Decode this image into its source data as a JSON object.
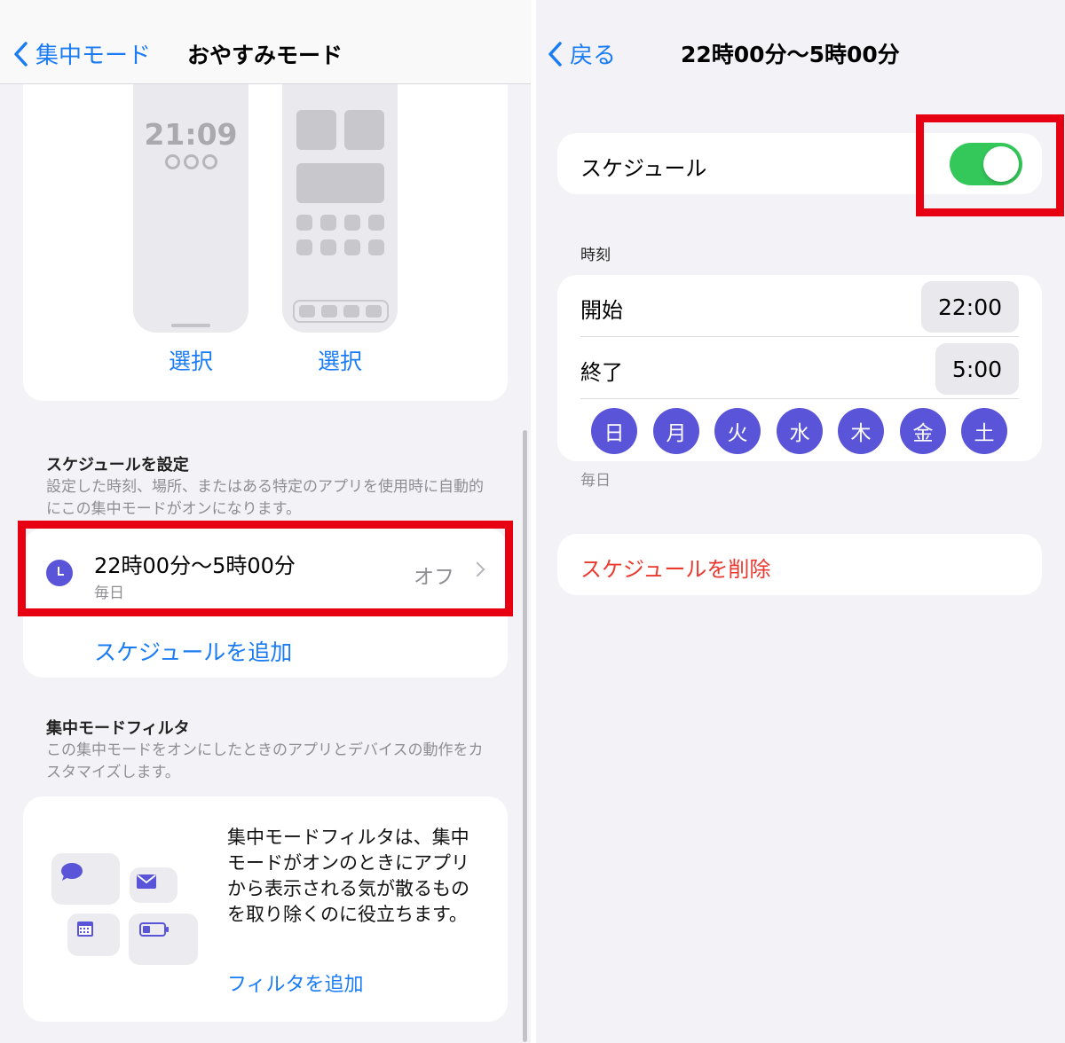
{
  "left": {
    "nav": {
      "back_label": "集中モード",
      "title": "おやすみモード"
    },
    "lock_preview": {
      "time": "21:09",
      "select_label": "選択"
    },
    "home_preview": {
      "select_label": "選択"
    },
    "schedule_section": {
      "header": "スケジュールを設定",
      "footer": "設定した時刻、場所、またはある特定のアプリを使用時に自動的にこの集中モードがオンになります。",
      "item": {
        "title": "22時00分〜5時00分",
        "subtitle": "毎日",
        "value": "オフ"
      },
      "add_label": "スケジュールを追加"
    },
    "filter_section": {
      "header": "集中モードフィルタ",
      "footer": "この集中モードをオンにしたときのアプリとデバイスの動作をカスタマイズします。",
      "description": "集中モードフィルタは、集中モードがオンのときにアプリから表示される気が散るものを取り除くのに役立ちます。",
      "add_label": "フィルタを追加"
    }
  },
  "right": {
    "nav": {
      "back_label": "戻る",
      "title": "22時00分〜5時00分"
    },
    "schedule_toggle": {
      "label": "スケジュール",
      "on": true
    },
    "time_section": {
      "header": "時刻",
      "start_label": "開始",
      "start_value": "22:00",
      "end_label": "終了",
      "end_value": "5:00",
      "days": [
        "日",
        "月",
        "火",
        "水",
        "木",
        "金",
        "土"
      ],
      "footer": "毎日"
    },
    "delete_label": "スケジュールを削除"
  },
  "colors": {
    "accent": "#1a7cf5",
    "highlight": "#e60012",
    "toggle_on": "#34c759",
    "day_circle": "#5a55d8",
    "destructive": "#ea3a2f"
  }
}
